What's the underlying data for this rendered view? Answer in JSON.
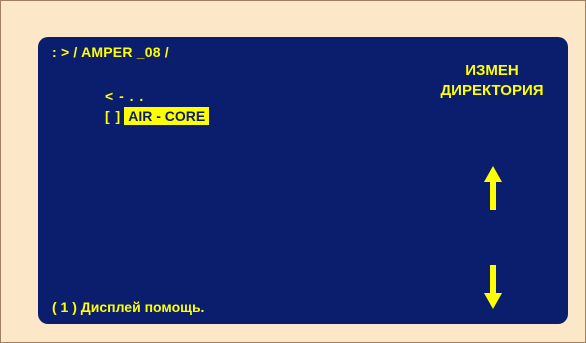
{
  "screen": {
    "path": ": > / AMPER _08 /",
    "entries": {
      "up": "< - . .",
      "selected_marker": "[  ]",
      "selected_name": "AIR - CORE"
    },
    "side_label_line1": "ИЗМЕН",
    "side_label_line2": "ДИРЕКТОРИЯ",
    "help": "( 1 ) Дисплей помощь.",
    "icons": {
      "up": "arrow-up-icon",
      "down": "arrow-down-icon"
    }
  },
  "colors": {
    "background": "#fce7c9",
    "screen": "#0b1e6e",
    "text": "#ffff00"
  }
}
